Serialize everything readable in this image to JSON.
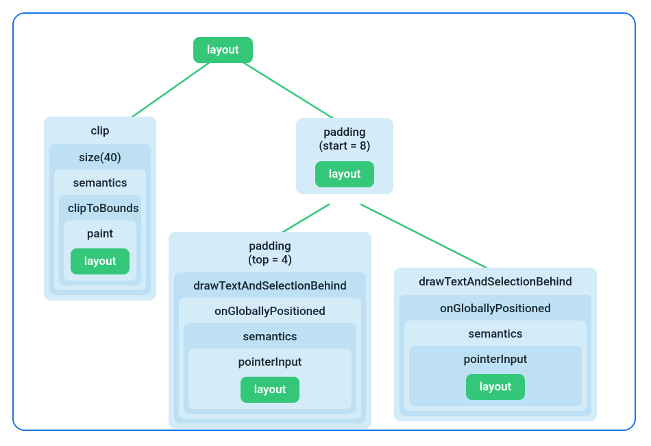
{
  "diagram": {
    "root": {
      "label": "layout"
    },
    "left": {
      "m0": "clip",
      "m1": "size(40)",
      "m2": "semantics",
      "m3": "clipToBounds",
      "m4": "paint",
      "leaf": "layout"
    },
    "right": {
      "m0": "padding\n(start = 8)",
      "leaf": "layout"
    },
    "bottomLeft": {
      "m0": "padding\n(top = 4)",
      "m1": "drawTextAndSelectionBehind",
      "m2": "onGloballyPositioned",
      "m3": "semantics",
      "m4": "pointerInput",
      "leaf": "layout"
    },
    "bottomRight": {
      "m0": "drawTextAndSelectionBehind",
      "m1": "onGloballyPositioned",
      "m2": "semantics",
      "m3": "pointerInput",
      "leaf": "layout"
    }
  }
}
